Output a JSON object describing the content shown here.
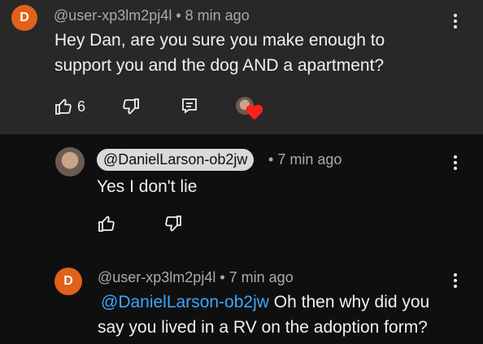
{
  "comment1": {
    "avatar_letter": "D",
    "username": "@user-xp3lm2pj4l",
    "time": "8 min ago",
    "text_line1": "Hey Dan, are you sure you make enough to",
    "text_line2": "support you and the dog AND a apartment?",
    "like_count": "6"
  },
  "reply1": {
    "username_chip": "@DanielLarson-ob2jw",
    "time": "7 min ago",
    "text": "Yes I don't lie"
  },
  "reply2": {
    "avatar_letter": "D",
    "username": "@user-xp3lm2pj4l",
    "time": "7 min ago",
    "mention": "@DanielLarson-ob2jw",
    "text_line1_rest": "Oh then why did you",
    "text_line2": "say you lived in a RV on the adoption form?"
  },
  "icons": {
    "like": "thumbs-up-icon",
    "dislike": "thumbs-down-icon",
    "reply": "reply-icon",
    "heart": "heart-icon",
    "more": "more-vert-icon"
  },
  "colors": {
    "accent_link": "#3ea6ff",
    "avatar_orange": "#e0611a",
    "heart_red": "#ff1f1f"
  }
}
